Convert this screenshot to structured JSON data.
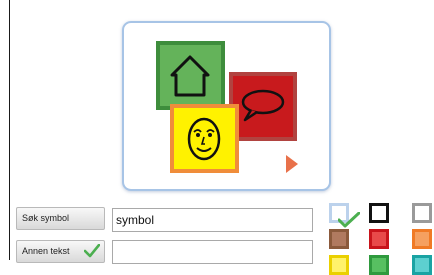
{
  "symbol_preview": {
    "tiles": [
      {
        "symbol": "house-icon",
        "color": "#64b35a"
      },
      {
        "symbol": "speech-bubble-icon",
        "color": "#c81a1d"
      },
      {
        "symbol": "smiley-face-icon",
        "color": "#fff200"
      }
    ],
    "next_arrow_color": "#e8714a"
  },
  "controls": {
    "search_symbol_label": "Søk symbol",
    "other_text_label": "Annen tekst",
    "symbol_field_value": "symbol",
    "other_text_value": ""
  },
  "color_palette": {
    "selected": "light-blue",
    "swatches": [
      "light-blue",
      "black",
      "grey",
      "brown",
      "red",
      "orange",
      "yellow",
      "green",
      "teal"
    ],
    "check_color": "#4caf50"
  }
}
